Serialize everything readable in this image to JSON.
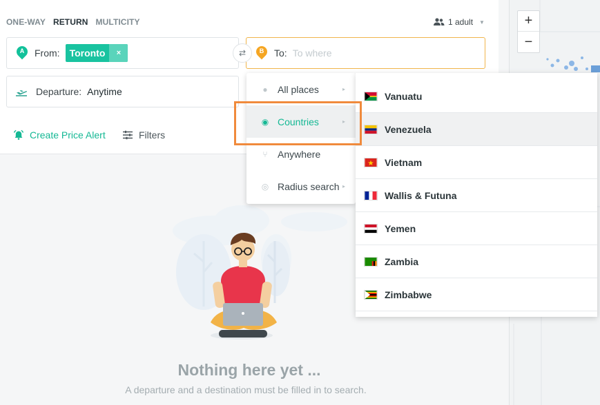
{
  "trip_types": [
    "ONE-WAY",
    "RETURN",
    "MULTICITY"
  ],
  "active_trip_type": "RETURN",
  "passengers": {
    "label": "1 adult"
  },
  "from": {
    "pin": "A",
    "label": "From:",
    "chip": "Toronto",
    "chip_remove": "×"
  },
  "to": {
    "pin": "B",
    "label": "To:",
    "placeholder": "To where"
  },
  "departure": {
    "label": "Departure:",
    "value": "Anytime"
  },
  "actions": {
    "alert": "Create Price Alert",
    "filters": "Filters"
  },
  "place_menu": [
    {
      "label": "All places",
      "icon": "pin-icon",
      "arrow": "▸"
    },
    {
      "label": "Countries",
      "icon": "globe-icon",
      "arrow": "▸"
    },
    {
      "label": "Anywhere",
      "icon": "fork-icon",
      "arrow": ""
    },
    {
      "label": "Radius search",
      "icon": "radius-icon",
      "arrow": "▸"
    }
  ],
  "countries": [
    "Vanuatu",
    "Venezuela",
    "Vietnam",
    "Wallis & Futuna",
    "Yemen",
    "Zambia",
    "Zimbabwe"
  ],
  "empty_state": {
    "title": "Nothing here yet ...",
    "subtitle": "A departure and a destination must be filled in to search."
  },
  "map": {
    "zoom_in": "+",
    "zoom_out": "−"
  },
  "colors": {
    "accent": "#19c3a0",
    "to_border": "#f0b44a",
    "highlight": "#f08a3c"
  }
}
